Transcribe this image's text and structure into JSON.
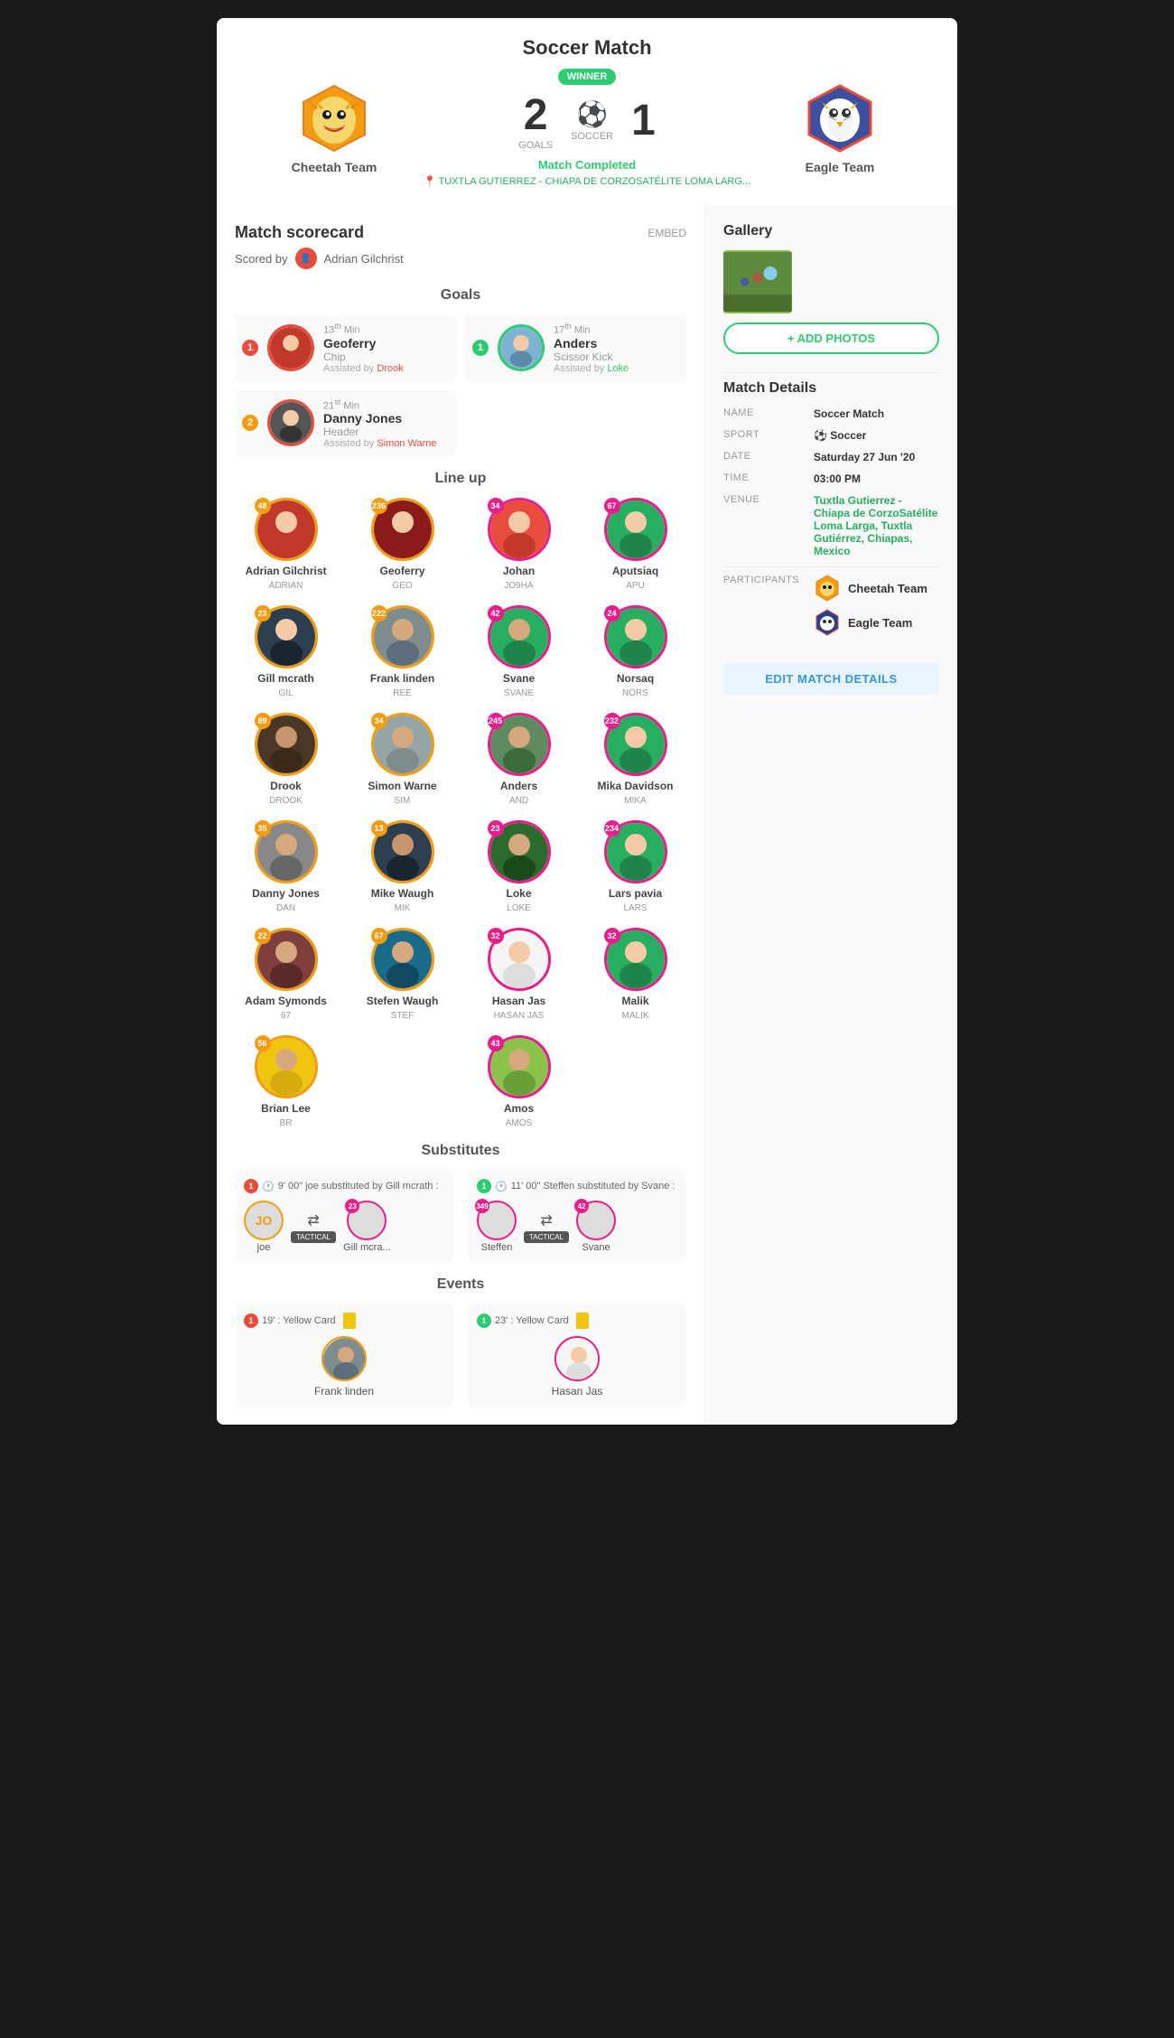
{
  "header": {
    "title": "Soccer Match",
    "winner_badge": "WINNER",
    "left_team": {
      "name": "Cheetah Team",
      "goals": "2",
      "goals_label": "GOALS"
    },
    "right_team": {
      "name": "Eagle Team",
      "goals": "1"
    },
    "sport": "SOCCER",
    "status": "Match Completed",
    "venue": "TUXTLA GUTIERREZ - CHIAPA DE CORZOSATÉLITE LOMA LARG..."
  },
  "scorecard": {
    "title": "Match scorecard",
    "embed_label": "EMBED",
    "scored_by_label": "Scored by",
    "scorer": "Adrian Gilchrist",
    "goals_title": "Goals",
    "goals": [
      {
        "team": 1,
        "minute": "13",
        "minute_sup": "th",
        "minute_suffix": "Min",
        "player": "Geoferry",
        "type": "Chip",
        "assist": "Drook",
        "color": "orange"
      },
      {
        "team": 1,
        "minute": "17",
        "minute_sup": "th",
        "minute_suffix": "Min",
        "player": "Anders",
        "type": "Scissor Kick",
        "assist": "Loke",
        "color": "pink"
      },
      {
        "team": 2,
        "minute": "21",
        "minute_sup": "st",
        "minute_suffix": "Min",
        "player": "Danny Jones",
        "type": "Header",
        "assist": "Simon Warne",
        "color": "orange"
      }
    ],
    "lineup_title": "Line up",
    "players": [
      {
        "name": "Adrian Gilchrist",
        "code": "ADRIAN",
        "number": "48",
        "color": "orange"
      },
      {
        "name": "Geoferry",
        "code": "GEO",
        "number": "236",
        "color": "orange"
      },
      {
        "name": "Johan",
        "code": "JO9HA",
        "number": "34",
        "color": "pink"
      },
      {
        "name": "Aputsiaq",
        "code": "APU",
        "number": "67",
        "color": "pink"
      },
      {
        "name": "Gill mcrath",
        "code": "GIL",
        "number": "23",
        "color": "orange"
      },
      {
        "name": "Frank linden",
        "code": "REE",
        "number": "222",
        "color": "orange"
      },
      {
        "name": "Svane",
        "code": "SVANE",
        "number": "42",
        "color": "pink"
      },
      {
        "name": "Norsaq",
        "code": "NORS",
        "number": "24",
        "color": "pink"
      },
      {
        "name": "Drook",
        "code": "DROOK",
        "number": "89",
        "color": "orange"
      },
      {
        "name": "Simon Warne",
        "code": "SIM",
        "number": "34",
        "color": "orange"
      },
      {
        "name": "Anders",
        "code": "AND",
        "number": "245",
        "color": "pink"
      },
      {
        "name": "Mika Davidson",
        "code": "MIKA",
        "number": "232",
        "color": "pink"
      },
      {
        "name": "Danny Jones",
        "code": "DAN",
        "number": "35",
        "color": "orange"
      },
      {
        "name": "Mike Waugh",
        "code": "MIK",
        "number": "13",
        "color": "orange"
      },
      {
        "name": "Loke",
        "code": "LOKE",
        "number": "23",
        "color": "pink"
      },
      {
        "name": "Lars pavia",
        "code": "LARS",
        "number": "234",
        "color": "pink"
      },
      {
        "name": "Adam Symonds",
        "code": "67",
        "number": "22",
        "color": "orange"
      },
      {
        "name": "Stefen Waugh",
        "code": "STEF",
        "number": "67",
        "color": "orange"
      },
      {
        "name": "Hasan Jas",
        "code": "HASAN JAS",
        "number": "32",
        "color": "pink"
      },
      {
        "name": "Malik",
        "code": "MALIK",
        "number": "32",
        "color": "pink"
      },
      {
        "name": "Brian Lee",
        "code": "BR",
        "number": "56",
        "color": "orange"
      },
      {
        "name": "",
        "code": "",
        "number": "",
        "color": ""
      },
      {
        "name": "Amos",
        "code": "AMOS",
        "number": "43",
        "color": "pink"
      },
      {
        "name": "",
        "code": "",
        "number": "",
        "color": ""
      }
    ],
    "substitutes_title": "Substitutes",
    "substitutes": [
      {
        "team": 1,
        "time": "9' 00\"",
        "description": "joe substituted by Gill mcrath :",
        "out_player": "joe",
        "out_code": "JO",
        "in_player": "Gill mcra...",
        "in_number": "23",
        "tactical": true
      },
      {
        "team": 1,
        "time": "11' 00\"",
        "description": "Steffen substituted by Svane :",
        "out_player": "Steffen",
        "out_number": "349",
        "in_player": "Svane",
        "in_number": "42",
        "tactical": true
      }
    ],
    "events_title": "Events",
    "events": [
      {
        "team": 1,
        "minute": "19'",
        "type": "Yellow Card",
        "player": "Frank linden",
        "color": "orange"
      },
      {
        "team": 1,
        "minute": "23'",
        "type": "Yellow Card",
        "player": "Hasan Jas",
        "color": "pink"
      }
    ]
  },
  "gallery": {
    "title": "Gallery",
    "add_photos_label": "+ ADD PHOTOS"
  },
  "match_details": {
    "title": "Match Details",
    "rows": [
      {
        "label": "NAME",
        "value": "Soccer Match",
        "type": "normal"
      },
      {
        "label": "SPORT",
        "value": "⚽ Soccer",
        "type": "normal"
      },
      {
        "label": "DATE",
        "value": "Saturday 27 Jun '20",
        "type": "normal"
      },
      {
        "label": "TIME",
        "value": "03:00 PM",
        "type": "normal"
      },
      {
        "label": "VENUE",
        "value": "Tuxtla Gutierrez - Chiapa de CorzoSatélite Loma Larga, Tuxtla Gutiérrez, Chiapas, Mexico",
        "type": "link"
      }
    ],
    "participants_label": "PARTICIPANTS",
    "participants": [
      {
        "name": "Cheetah Team"
      },
      {
        "name": "Eagle Team"
      }
    ],
    "edit_button": "EDIT MATCH DETAILS"
  }
}
